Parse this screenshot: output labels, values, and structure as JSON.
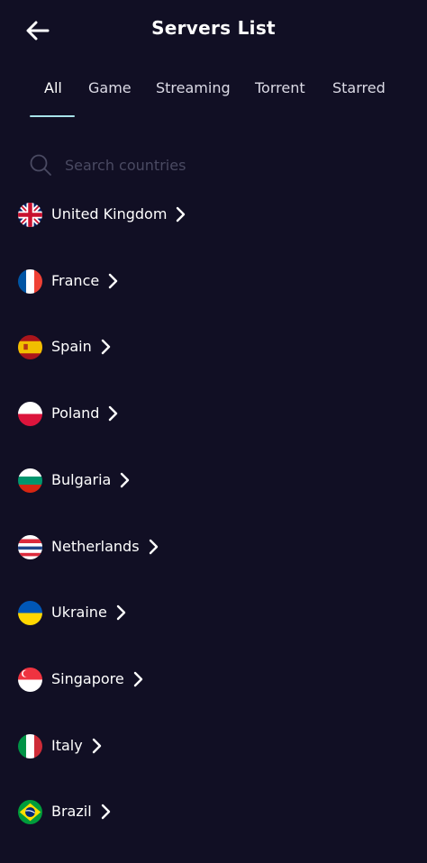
{
  "header": {
    "title": "Servers List",
    "back_icon": "arrow-left-icon"
  },
  "tabs": [
    {
      "label": "All",
      "active": true
    },
    {
      "label": "Game",
      "active": false
    },
    {
      "label": "Streaming",
      "active": false
    },
    {
      "label": "Torrent",
      "active": false
    },
    {
      "label": "Starred",
      "active": false
    }
  ],
  "search": {
    "placeholder": "Search countries",
    "value": "",
    "icon": "search-icon"
  },
  "countries": [
    {
      "name": "United Kingdom",
      "flag": "uk"
    },
    {
      "name": "France",
      "flag": "fr"
    },
    {
      "name": "Spain",
      "flag": "es"
    },
    {
      "name": "Poland",
      "flag": "pl"
    },
    {
      "name": "Bulgaria",
      "flag": "bg"
    },
    {
      "name": "Netherlands",
      "flag": "nl"
    },
    {
      "name": "Ukraine",
      "flag": "ua"
    },
    {
      "name": "Singapore",
      "flag": "sg"
    },
    {
      "name": "Italy",
      "flag": "it"
    },
    {
      "name": "Brazil",
      "flag": "br"
    }
  ],
  "colors": {
    "background": "#110f24",
    "tab_indicator": "#a8e3ea",
    "text": "#ffffff",
    "placeholder": "#4a4a62"
  }
}
